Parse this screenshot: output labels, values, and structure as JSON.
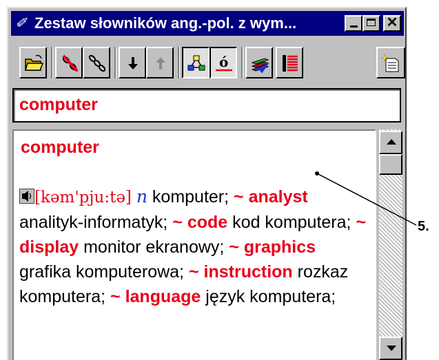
{
  "window": {
    "title": "Zestaw słowników ang.-pol. z wym...",
    "title_icon": "dictionary-app-icon"
  },
  "toolbar": {
    "buttons": [
      {
        "name": "open-folder-icon"
      },
      {
        "name": "unlink-icon"
      },
      {
        "name": "link-chain-icon"
      },
      {
        "name": "arrow-down-icon"
      },
      {
        "name": "arrow-up-icon"
      },
      {
        "name": "hierarchy-icon"
      },
      {
        "name": "accent-o-icon"
      },
      {
        "name": "books-check-icon"
      },
      {
        "name": "list-red-icon"
      },
      {
        "name": "new-page-icon"
      }
    ]
  },
  "search": {
    "value": "computer"
  },
  "entry": {
    "headword": "computer",
    "pronunciation": "[kəm'pju:tə]",
    "pos": "n",
    "text_1": " komputer; ",
    "tilde": "~",
    "phrase_1": "analyst",
    "trans_1": " analityk-informatyk; ",
    "phrase_2": "code",
    "trans_2": " kod komputera; ",
    "phrase_3": "display",
    "trans_3": " monitor ekranowy; ",
    "phrase_4": "graphics",
    "trans_4": " grafika komputerowa; ",
    "phrase_5": "instruction",
    "trans_5": " rozkaz komputera; ",
    "phrase_6": "language",
    "trans_6": " język komputera;"
  },
  "callout": {
    "label": "5."
  },
  "colors": {
    "titlebar": "#000080",
    "headword_red": "#e8001c",
    "pos_blue": "#1a2ed8",
    "chrome": "#c0c0c0"
  }
}
